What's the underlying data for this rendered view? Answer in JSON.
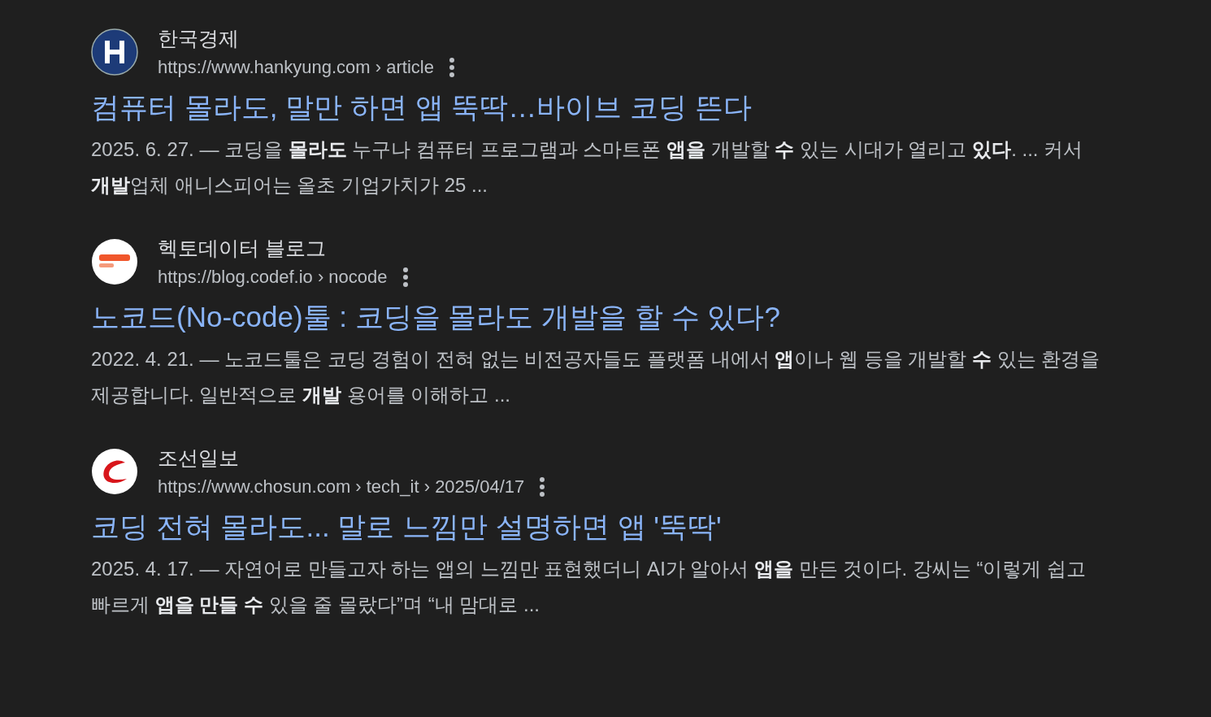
{
  "results": [
    {
      "kind": "h",
      "site": "한국경제",
      "url": "https://www.hankyung.com › article",
      "title": "컴퓨터 몰라도, 말만 하면 앱 뚝딱…바이브 코딩 뜬다",
      "snippet": "2025. 6. 27. — 코딩을 **몰라도** 누구나 컴퓨터 프로그램과 스마트폰 **앱을** 개발할 **수** 있는 시대가 열리고 **있다**. ... 커서 **개발**업체 애니스피어는 올초 기업가치가 25 ..."
    },
    {
      "kind": "hecto",
      "site": "헥토데이터 블로그",
      "url": "https://blog.codef.io › nocode",
      "title": "노코드(No-code)툴 : 코딩을 몰라도 개발을 할 수 있다?",
      "snippet": "2022. 4. 21. — 노코드툴은 코딩 경험이 전혀 없는 비전공자들도 플랫폼 내에서 **앱**이나 웹 등을 개발할 **수** 있는 환경을 제공합니다. 일반적으로 **개발** 용어를 이해하고 ..."
    },
    {
      "kind": "chosun",
      "site": "조선일보",
      "url": "https://www.chosun.com › tech_it › 2025/04/17",
      "title": "코딩 전혀 몰라도... 말로 느낌만 설명하면 앱 '뚝딱'",
      "snippet": "2025. 4. 17. — 자연어로 만들고자 하는 앱의 느낌만 표현했더니 AI가 알아서 **앱을** 만든 것이다. 강씨는 “이렇게 쉽고 빠르게 **앱을 만들 수** 있을 줄 몰랐다”며 “내 맘대로 ..."
    }
  ]
}
